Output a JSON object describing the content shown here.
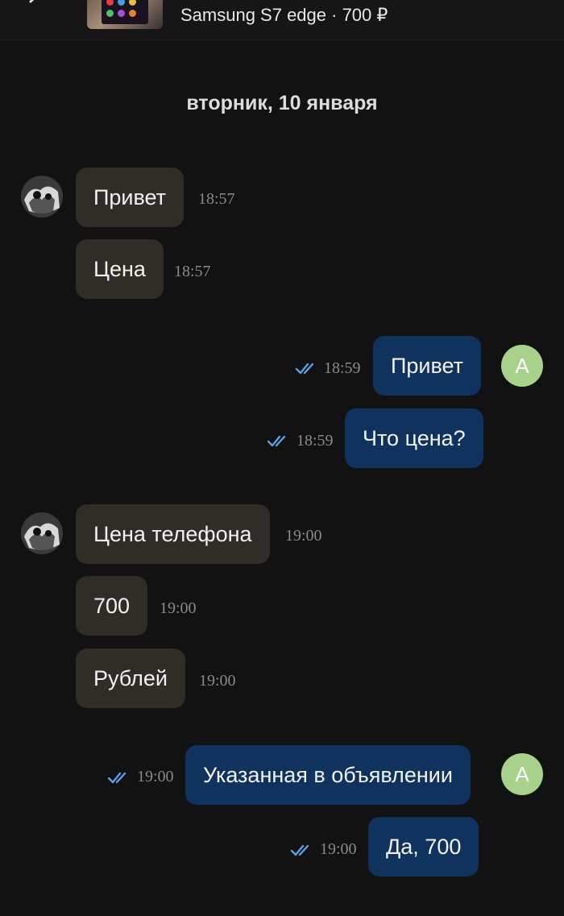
{
  "header": {
    "listing_title": "Samsung S7 edge · 700 ₽"
  },
  "date_separator": "вторник, 10 января",
  "contact_avatar_letter": "A",
  "colors": {
    "incoming_bubble": "#302c27",
    "outgoing_bubble": "#10325e",
    "read_check": "#5aa0e8",
    "own_avatar": "#a8d28a",
    "background": "#121212"
  },
  "messages": [
    {
      "direction": "in",
      "text": "Привет",
      "time": "18:57"
    },
    {
      "direction": "in",
      "text": "Цена",
      "time": "18:57"
    },
    {
      "direction": "out",
      "text": "Привет",
      "time": "18:59",
      "status": "read"
    },
    {
      "direction": "out",
      "text": "Что цена?",
      "time": "18:59",
      "status": "read"
    },
    {
      "direction": "in",
      "text": "Цена телефона",
      "time": "19:00"
    },
    {
      "direction": "in",
      "text": "700",
      "time": "19:00"
    },
    {
      "direction": "in",
      "text": "Рублей",
      "time": "19:00"
    },
    {
      "direction": "out",
      "text": "Указанная в объявлении",
      "time": "19:00",
      "status": "read"
    },
    {
      "direction": "out",
      "text": "Да, 700",
      "time": "19:00",
      "status": "read"
    }
  ]
}
